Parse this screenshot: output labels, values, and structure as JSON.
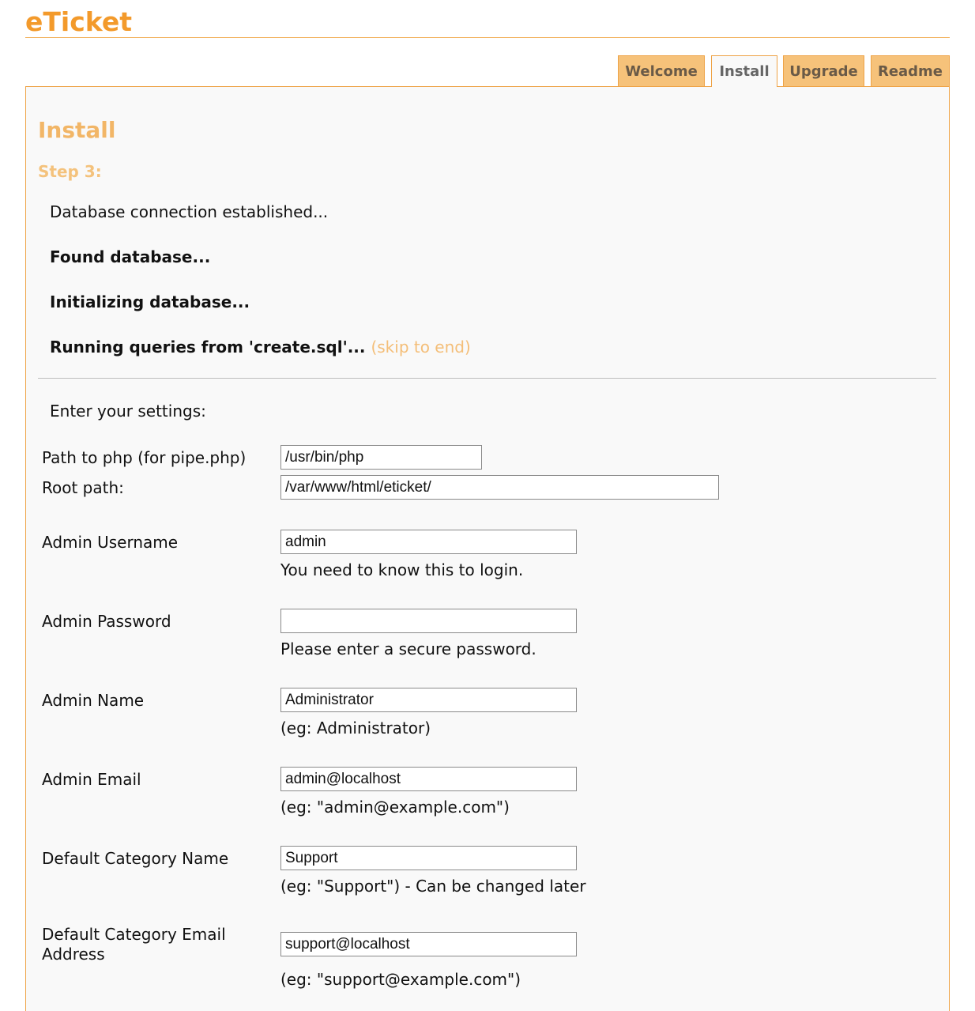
{
  "app": {
    "title": "eTicket"
  },
  "tabs": [
    {
      "label": "Welcome",
      "active": false
    },
    {
      "label": "Install",
      "active": true
    },
    {
      "label": "Upgrade",
      "active": false
    },
    {
      "label": "Readme",
      "active": false
    }
  ],
  "content": {
    "heading": "Install",
    "step": "Step 3:",
    "messages": {
      "connection": "Database connection established...",
      "found": "Found database...",
      "initializing": "Initializing database...",
      "running": "Running queries from 'create.sql'...",
      "skip_link": "(skip to end)"
    },
    "settings_intro": "Enter your settings:"
  },
  "form": {
    "php_path": {
      "label": "Path to php (for pipe.php)",
      "value": "/usr/bin/php"
    },
    "root_path": {
      "label": "Root path:",
      "value": "/var/www/html/eticket/"
    },
    "admin_username": {
      "label": "Admin Username",
      "value": "admin",
      "hint": "You need to know this to login."
    },
    "admin_password": {
      "label": "Admin Password",
      "value": "",
      "hint": "Please enter a secure password."
    },
    "admin_name": {
      "label": "Admin Name",
      "value": "Administrator",
      "hint": "(eg: Administrator)"
    },
    "admin_email": {
      "label": "Admin Email",
      "value": "admin@localhost",
      "hint": "(eg: \"admin@example.com\")"
    },
    "category_name": {
      "label": "Default Category Name",
      "value": "Support",
      "hint": "(eg: \"Support\") - Can be changed later"
    },
    "category_email": {
      "label_line1": "Default Category Email",
      "label_line2": "Address",
      "value": "support@localhost",
      "hint": "(eg: \"support@example.com\")"
    }
  },
  "colors": {
    "brand": "#f39a2b",
    "tab_bg": "#f6c27a",
    "tab_border": "#eea346",
    "panel_bg": "#f9f9f9"
  }
}
